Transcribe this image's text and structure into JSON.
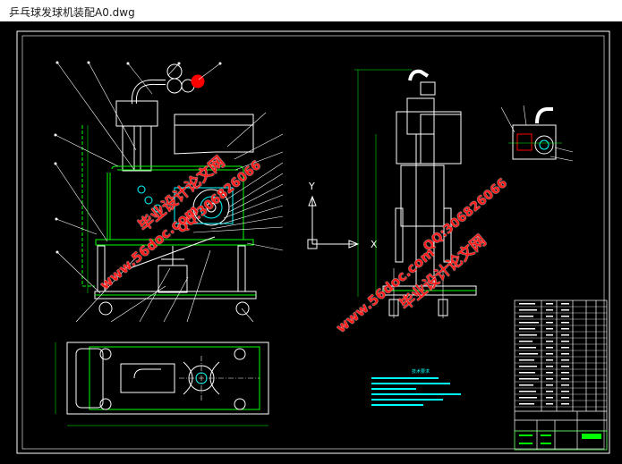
{
  "window": {
    "title": "乒乓球发球机装配A0.dwg"
  },
  "drawing": {
    "axis_y": "Y",
    "axis_x": "X",
    "notes_heading": "技术要求",
    "watermarks": [
      {
        "text": "毕业设计论文网",
        "id": "wm1"
      },
      {
        "text": "QQ:306826066",
        "id": "wm2"
      },
      {
        "text": "www.56doc.com",
        "id": "wm3"
      },
      {
        "text": "www.56doc.com",
        "id": "wm4"
      },
      {
        "text": "QQ:306826066",
        "id": "wm5"
      },
      {
        "text": "毕业设计论文网",
        "id": "wm6"
      }
    ]
  },
  "colors": {
    "background": "#000000",
    "lines": "#ffffff",
    "green": "#00ff00",
    "cyan": "#00ffff",
    "watermark": "#ff1a1a"
  }
}
